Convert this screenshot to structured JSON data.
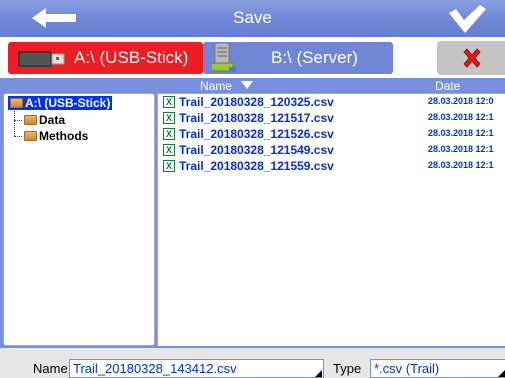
{
  "titlebar": {
    "title": "Save",
    "back_icon": "arrow-left",
    "ok_icon": "checkmark"
  },
  "tabs": [
    {
      "label": "A:\\ (USB-Stick)",
      "icon": "usb-stick-icon",
      "active": true
    },
    {
      "label": "B:\\ (Server)",
      "icon": "server-icon",
      "active": false
    }
  ],
  "close_icon": "red-x",
  "columns": {
    "name": "Name",
    "date": "Date"
  },
  "tree": [
    {
      "label": "A:\\ (USB-Stick)",
      "selected": true
    },
    {
      "label": "Data",
      "selected": false
    },
    {
      "label": "Methods",
      "selected": false
    }
  ],
  "files": [
    {
      "name": "Trail_20180328_120325.csv",
      "date": "28.03.2018  12:0"
    },
    {
      "name": "Trail_20180328_121517.csv",
      "date": "28.03.2018  12:1"
    },
    {
      "name": "Trail_20180328_121526.csv",
      "date": "28.03.2018  12:1"
    },
    {
      "name": "Trail_20180328_121549.csv",
      "date": "28.03.2018  12:1"
    },
    {
      "name": "Trail_20180328_121559.csv",
      "date": "28.03.2018  12:1"
    }
  ],
  "bottom": {
    "name_label": "Name",
    "name_value": "Trail_20180328_143412.csv",
    "type_label": "Type",
    "type_value": "*.csv (Trail)"
  },
  "colors": {
    "accent": "#6f86d6",
    "active_tab": "#ee1c24",
    "selection": "#0033ee",
    "file_text": "#0033cc"
  }
}
